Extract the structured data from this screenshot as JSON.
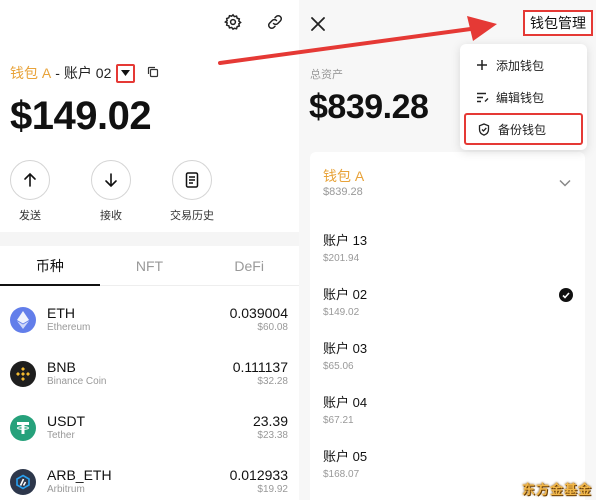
{
  "left": {
    "top_icons": [
      "gear-icon",
      "link-icon"
    ],
    "wallet_name": "钱包 A",
    "separator": "-",
    "account_name": "账户 02",
    "balance": "$149.02",
    "actions": [
      {
        "label": "发送",
        "icon": "arrow-up-icon"
      },
      {
        "label": "接收",
        "icon": "arrow-down-icon"
      },
      {
        "label": "交易历史",
        "icon": "document-icon"
      }
    ],
    "tabs": [
      {
        "label": "币种",
        "active": true
      },
      {
        "label": "NFT",
        "active": false
      },
      {
        "label": "DeFi",
        "active": false
      }
    ],
    "tokens": [
      {
        "symbol": "ETH",
        "name": "Ethereum",
        "amount": "0.039004",
        "usd": "$60.08",
        "icon_color": "#627eea"
      },
      {
        "symbol": "BNB",
        "name": "Binance Coin",
        "amount": "0.111137",
        "usd": "$32.28",
        "icon_color": "#1e1e1e"
      },
      {
        "symbol": "USDT",
        "name": "Tether",
        "amount": "23.39",
        "usd": "$23.38",
        "icon_color": "#26a17b"
      },
      {
        "symbol": "ARB_ETH",
        "name": "Arbitrum",
        "amount": "0.012933",
        "usd": "$19.92",
        "icon_color": "#2d374b"
      }
    ]
  },
  "right": {
    "total_label": "总资产",
    "total_amount": "$839.28",
    "manage_label": "钱包管理",
    "menu": [
      {
        "label": "添加钱包",
        "icon": "plus-icon"
      },
      {
        "label": "编辑钱包",
        "icon": "edit-list-icon"
      },
      {
        "label": "备份钱包",
        "icon": "shield-icon"
      }
    ],
    "wallet": {
      "name": "钱包 A",
      "amount": "$839.28"
    },
    "accounts": [
      {
        "name": "账户 13",
        "value": "$201.94",
        "selected": false
      },
      {
        "name": "账户 02",
        "value": "$149.02",
        "selected": true
      },
      {
        "name": "账户 03",
        "value": "$65.06",
        "selected": false
      },
      {
        "name": "账户 04",
        "value": "$67.21",
        "selected": false
      },
      {
        "name": "账户 05",
        "value": "$168.07",
        "selected": false
      }
    ],
    "watermark": "东方金基金"
  },
  "colors": {
    "accent": "#e8a33a",
    "highlight": "#e53935"
  }
}
